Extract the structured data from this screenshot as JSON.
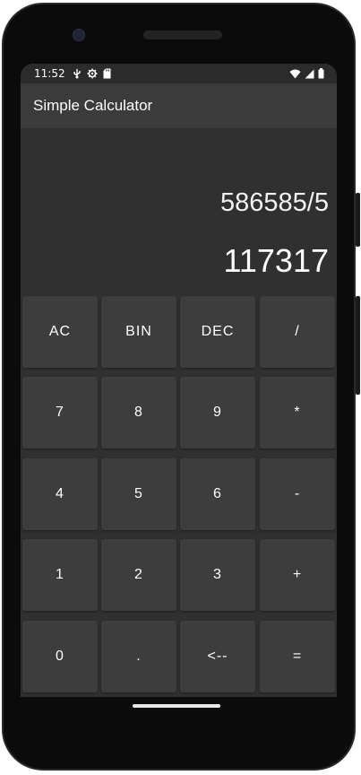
{
  "status_bar": {
    "time": "11:52",
    "left_icons": [
      "usb-debug-icon",
      "settings-icon",
      "sd-card-icon"
    ],
    "right_icons": [
      "wifi-icon",
      "signal-icon",
      "battery-icon"
    ]
  },
  "app_bar": {
    "title": "Simple Calculator"
  },
  "display": {
    "expression": "586585/5",
    "result": "117317"
  },
  "keypad": {
    "rows": [
      [
        "AC",
        "BIN",
        "DEC",
        "/"
      ],
      [
        "7",
        "8",
        "9",
        "*"
      ],
      [
        "4",
        "5",
        "6",
        "-"
      ],
      [
        "1",
        "2",
        "3",
        "+"
      ],
      [
        "0",
        ".",
        "<--",
        "="
      ]
    ]
  },
  "colors": {
    "background": "#303030",
    "app_bar": "#3b3b3b",
    "key": "#3d3d3d",
    "text": "#ffffff"
  }
}
